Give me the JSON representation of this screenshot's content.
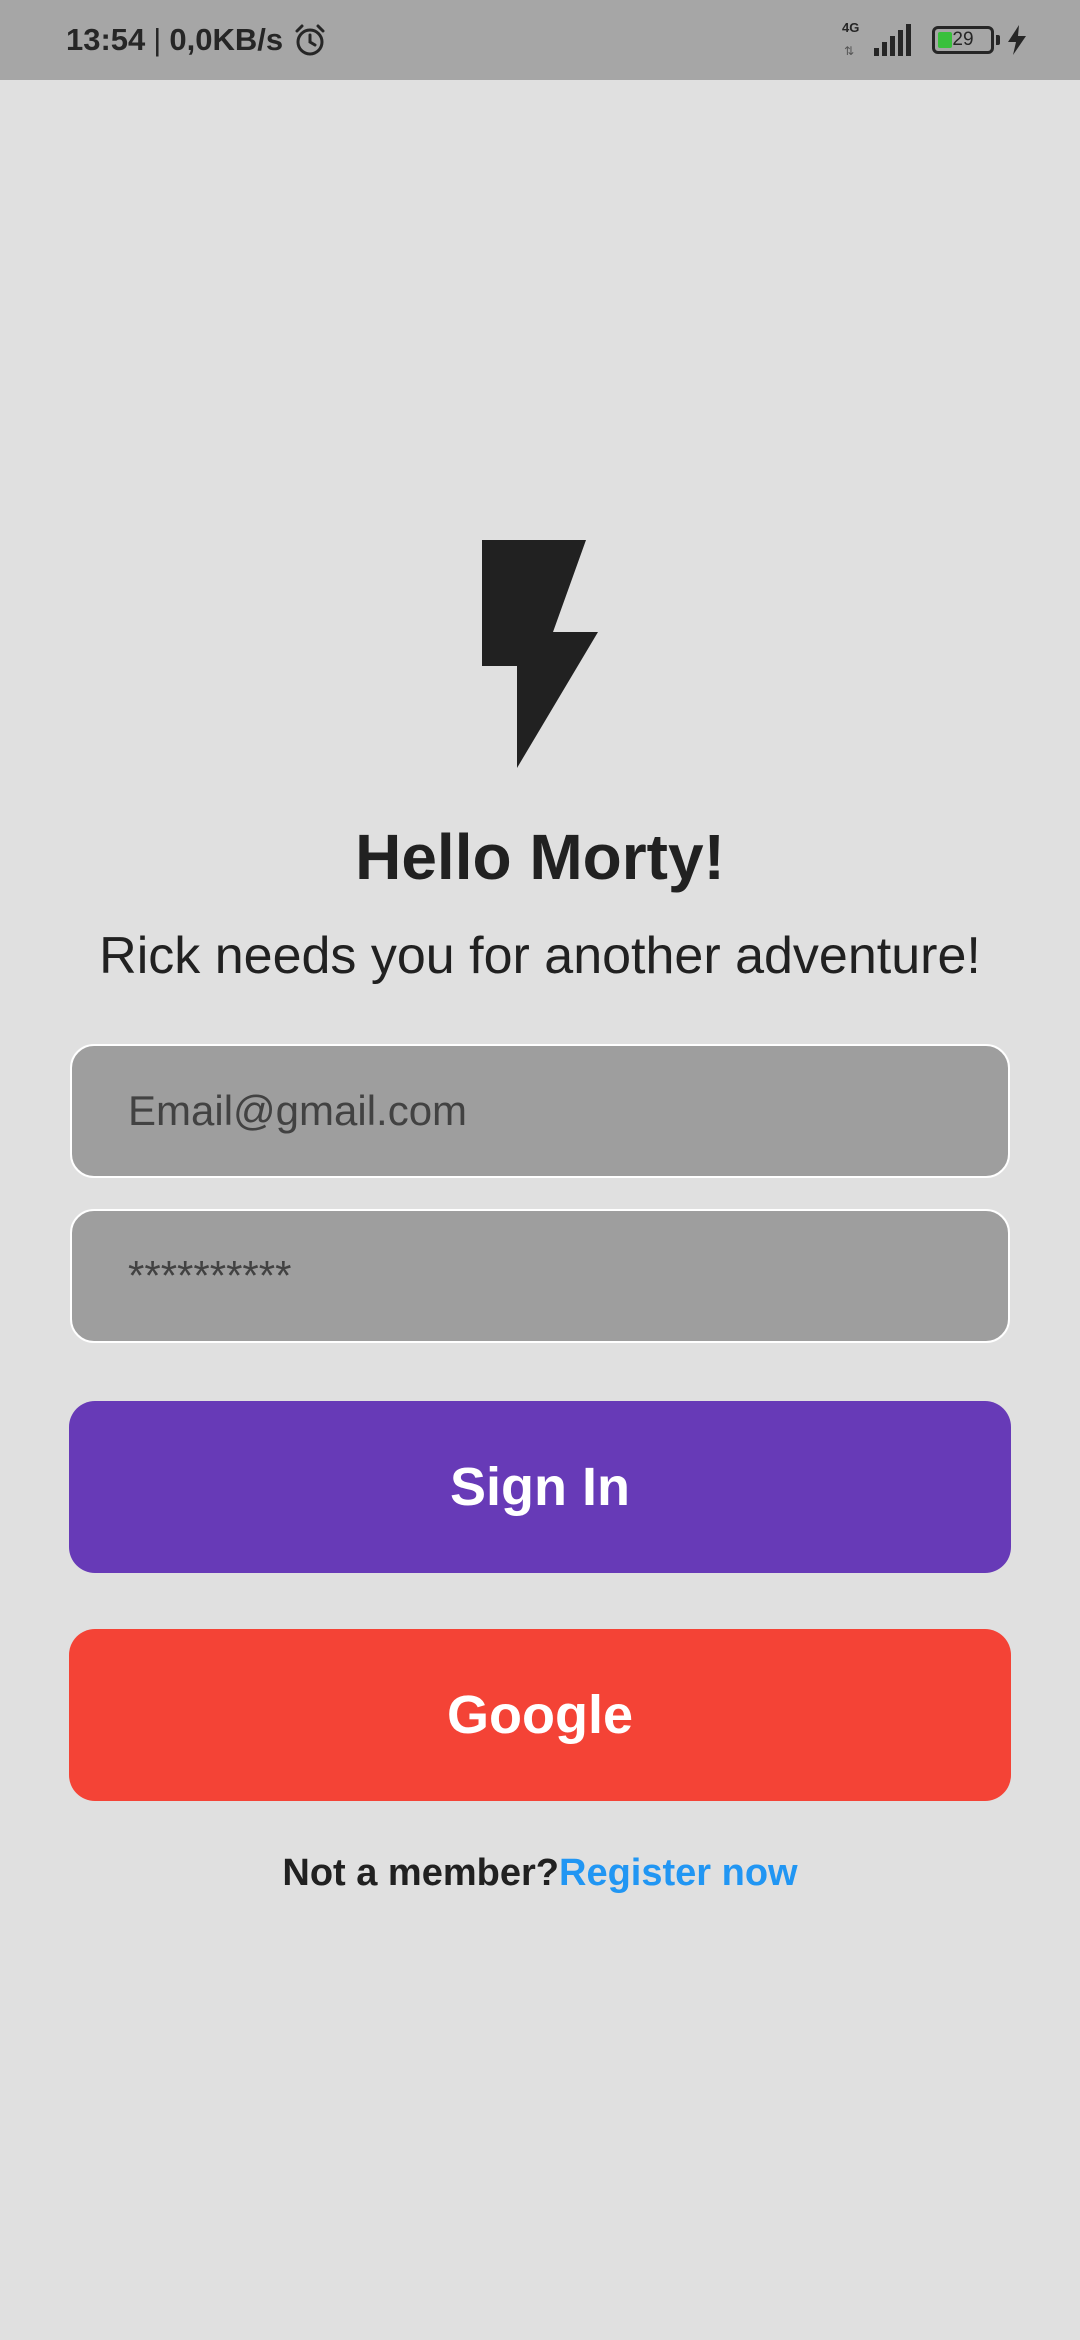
{
  "status_bar": {
    "time": "13:54",
    "separator": "|",
    "data_speed": "0,0KB/s",
    "network_type": "4G",
    "battery_level": "29",
    "icons": [
      "alarm-icon",
      "signal-icon",
      "battery-icon",
      "charging-icon"
    ]
  },
  "logo": {
    "icon": "lightning-bolt-icon",
    "color": "#212121"
  },
  "greeting": {
    "title": "Hello Morty!",
    "subtitle": "Rick needs you for another adventure!"
  },
  "form": {
    "email_placeholder": "Email@gmail.com",
    "password_placeholder": "**********"
  },
  "buttons": {
    "sign_in": "Sign In",
    "google": "Google"
  },
  "register": {
    "prompt": "Not a member?",
    "link": "Register now"
  },
  "colors": {
    "background": "#e0e0e0",
    "status_bar": "#a6a6a6",
    "sign_in": "#673ab7",
    "google": "#f44336",
    "link": "#2196f3",
    "field": "#9e9e9e"
  }
}
